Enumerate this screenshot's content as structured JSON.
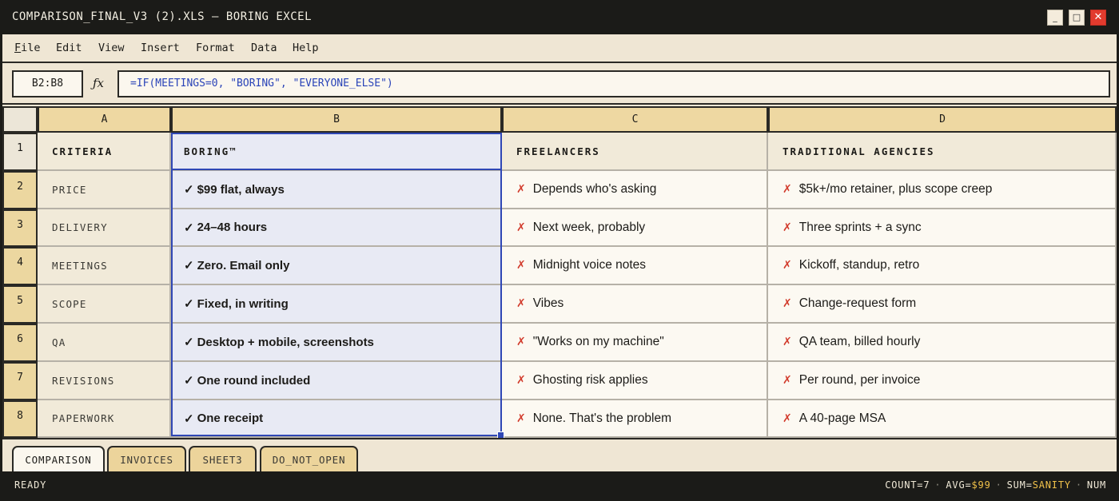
{
  "window": {
    "title": "COMPARISON_FINAL_V3 (2).XLS — BORING EXCEL",
    "controls": {
      "minimize": "_",
      "maximize": "□",
      "close": "✕"
    }
  },
  "menu": {
    "file_first": "F",
    "file_rest": "ile",
    "edit": "Edit",
    "view": "View",
    "insert": "Insert",
    "format": "Format",
    "data": "Data",
    "help": "Help"
  },
  "formula_bar": {
    "name_box": "B2:B8",
    "fx": "ƒx",
    "formula": "=IF(MEETINGS=0, \"BORING\", \"EVERYONE_ELSE\")"
  },
  "columns": [
    "A",
    "B",
    "C",
    "D"
  ],
  "rows": [
    "1",
    "2",
    "3",
    "4",
    "5",
    "6",
    "7",
    "8"
  ],
  "table": {
    "header": {
      "a": "CRITERIA",
      "b": "BORING™",
      "c": "FREELANCERS",
      "d": "TRADITIONAL AGENCIES"
    },
    "body": [
      {
        "a": "PRICE",
        "b": "$99 flat, always",
        "c": "Depends who's asking",
        "d": "$5k+/mo retainer, plus scope creep"
      },
      {
        "a": "DELIVERY",
        "b": "24–48 hours",
        "c": "Next week, probably",
        "d": "Three sprints + a sync"
      },
      {
        "a": "MEETINGS",
        "b": "Zero. Email only",
        "c": "Midnight voice notes",
        "d": "Kickoff, standup, retro"
      },
      {
        "a": "SCOPE",
        "b": "Fixed, in writing",
        "c": "Vibes",
        "d": "Change-request form"
      },
      {
        "a": "QA",
        "b": "Desktop + mobile, screenshots",
        "c": "\"Works on my machine\"",
        "d": "QA team, billed hourly"
      },
      {
        "a": "REVISIONS",
        "b": "One round included",
        "c": "Ghosting risk applies",
        "d": "Per round, per invoice"
      },
      {
        "a": "PAPERWORK",
        "b": "One receipt",
        "c": "None. That's the problem",
        "d": "A 40-page MSA"
      }
    ],
    "check_glyph": "✓",
    "cross_glyph": "✗"
  },
  "tabs": [
    {
      "label": "COMPARISON",
      "active": true
    },
    {
      "label": "INVOICES",
      "active": false
    },
    {
      "label": "SHEET3",
      "active": false
    },
    {
      "label": "DO_NOT_OPEN",
      "active": false
    }
  ],
  "status": {
    "left": "READY",
    "count": "COUNT=7",
    "avg_label": "AVG=",
    "avg_value": "$99",
    "sum_label": "SUM=",
    "sum_value": "SANITY",
    "mode": "NUM",
    "separator": "·"
  },
  "colors": {
    "selection": "#2f47b5",
    "header_fill": "#eed8a2",
    "cross": "#d23c2d",
    "status_highlight": "#f0c14a"
  }
}
